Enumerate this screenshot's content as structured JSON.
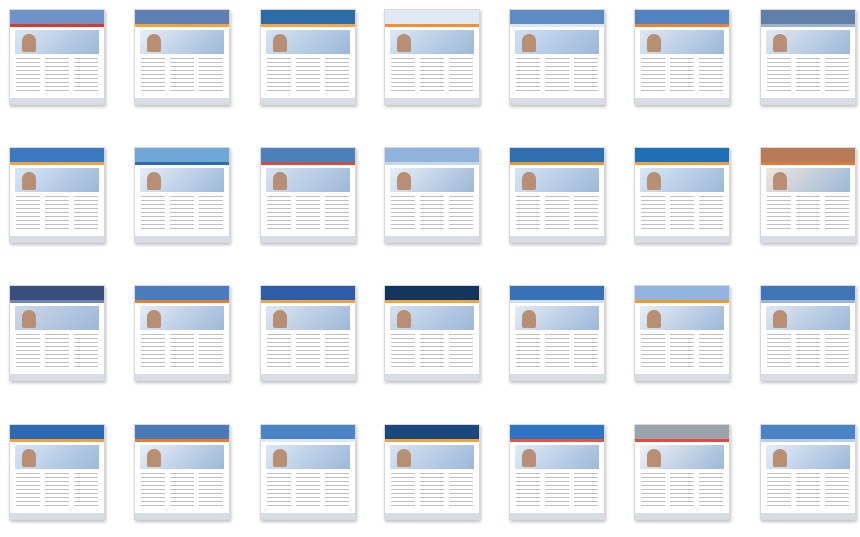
{
  "gallery": {
    "thumbnails": [
      {
        "band": "#6f93c6",
        "stripe": "#d93a2f",
        "hero": "#dbe7f5"
      },
      {
        "band": "#5d7fb4",
        "stripe": "#f0a23d",
        "hero": "#e8eef7"
      },
      {
        "band": "#2c6da8",
        "stripe": "#f4a64e",
        "hero": "#d5e4f3"
      },
      {
        "band": "#dfe8f5",
        "stripe": "#f09034",
        "hero": "#dbe7f5"
      },
      {
        "band": "#5c8ac4",
        "stripe": "#dbe7f5",
        "hero": "#cfe0f4"
      },
      {
        "band": "#4f82bf",
        "stripe": "#e8833a",
        "hero": "#dfe8f2"
      },
      {
        "band": "#5f7ea8",
        "stripe": "#9db1c9",
        "hero": "#e2e9f2"
      },
      {
        "band": "#3b78bf",
        "stripe": "#f0a23d",
        "hero": "#d8e6f6"
      },
      {
        "band": "#6fa8d6",
        "stripe": "#2c6da8",
        "hero": "#e4eef9"
      },
      {
        "band": "#4d7fb9",
        "stripe": "#d64b3f",
        "hero": "#d7e3f2"
      },
      {
        "band": "#8fb3da",
        "stripe": "#c7d7ea",
        "hero": "#e7eef7"
      },
      {
        "band": "#2f6fb2",
        "stripe": "#e59a34",
        "hero": "#d6e5f7"
      },
      {
        "band": "#1f6fb6",
        "stripe": "#f0a23d",
        "hero": "#d9e8f7"
      },
      {
        "band": "#b77b58",
        "stripe": "#e07c3b",
        "hero": "#f0e6df"
      },
      {
        "band": "#374f7a",
        "stripe": "#6b86b3",
        "hero": "#cdd8e8"
      },
      {
        "band": "#4a7bbf",
        "stripe": "#e67d32",
        "hero": "#e4ecf6"
      },
      {
        "band": "#2d5da8",
        "stripe": "#f0a23d",
        "hero": "#dfe7f3"
      },
      {
        "band": "#12345f",
        "stripe": "#f3a53a",
        "hero": "#d5e1f0"
      },
      {
        "band": "#3772b7",
        "stripe": "#d4dfec",
        "hero": "#e3ebf6"
      },
      {
        "band": "#92b4de",
        "stripe": "#f09a2a",
        "hero": "#e7eef7"
      },
      {
        "band": "#3f74b6",
        "stripe": "#9fb5d3",
        "hero": "#dfe7f3"
      },
      {
        "band": "#2d6ab4",
        "stripe": "#f0a23d",
        "hero": "#d7e6f7"
      },
      {
        "band": "#4a79b8",
        "stripe": "#e67d32",
        "hero": "#e7eef7"
      },
      {
        "band": "#4a84c6",
        "stripe": "#dfe9f6",
        "hero": "#dbe8f7"
      },
      {
        "band": "#1a477c",
        "stripe": "#f0a23d",
        "hero": "#d9e5f5"
      },
      {
        "band": "#2d74c6",
        "stripe": "#e05a39",
        "hero": "#e0ebf8"
      },
      {
        "band": "#9ba4ae",
        "stripe": "#e14a3d",
        "hero": "#eef1f5"
      },
      {
        "band": "#4b83c7",
        "stripe": "#b9cfe8",
        "hero": "#e4eef9"
      }
    ]
  }
}
